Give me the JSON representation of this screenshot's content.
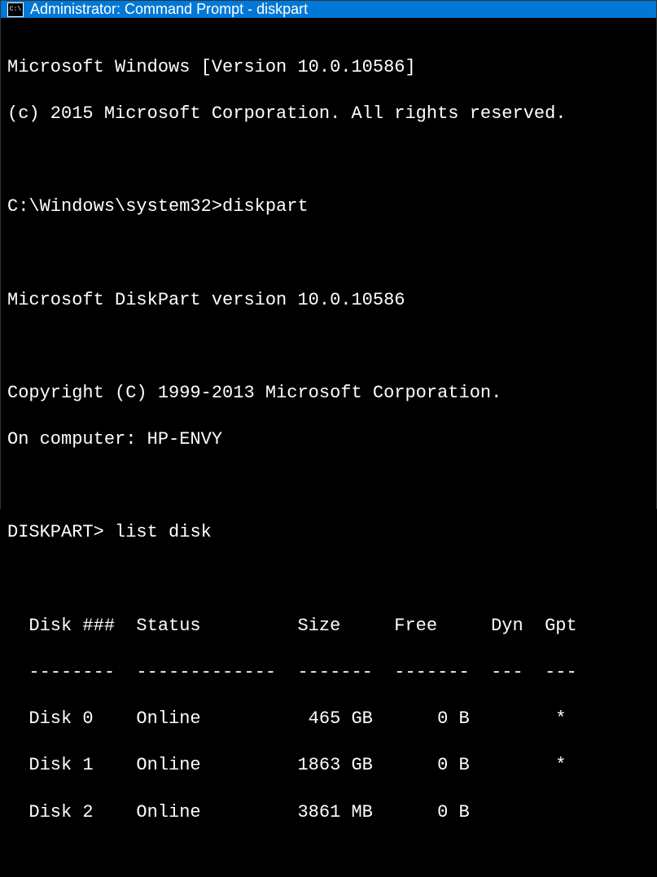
{
  "titlebar": {
    "icon_glyph": "C:\\",
    "text": "Administrator: Command Prompt - diskpart"
  },
  "terminal": {
    "os_version": "Microsoft Windows [Version 10.0.10586]",
    "copyright_os": "(c) 2015 Microsoft Corporation. All rights reserved.",
    "prompt1_path": "C:\\Windows\\system32>",
    "prompt1_cmd": "diskpart",
    "diskpart_version": "Microsoft DiskPart version 10.0.10586",
    "diskpart_copyright": "Copyright (C) 1999-2013 Microsoft Corporation.",
    "diskpart_computer": "On computer: HP-ENVY",
    "prompt2_path": "DISKPART>",
    "prompt2_cmd": "list disk",
    "table": {
      "header": "  Disk ###  Status         Size     Free     Dyn  Gpt",
      "divider": "  --------  -------------  -------  -------  ---  ---",
      "rows": [
        "  Disk 0    Online          465 GB      0 B        *",
        "  Disk 1    Online         1863 GB      0 B        *",
        "  Disk 2    Online         3861 MB      0 B"
      ]
    }
  }
}
